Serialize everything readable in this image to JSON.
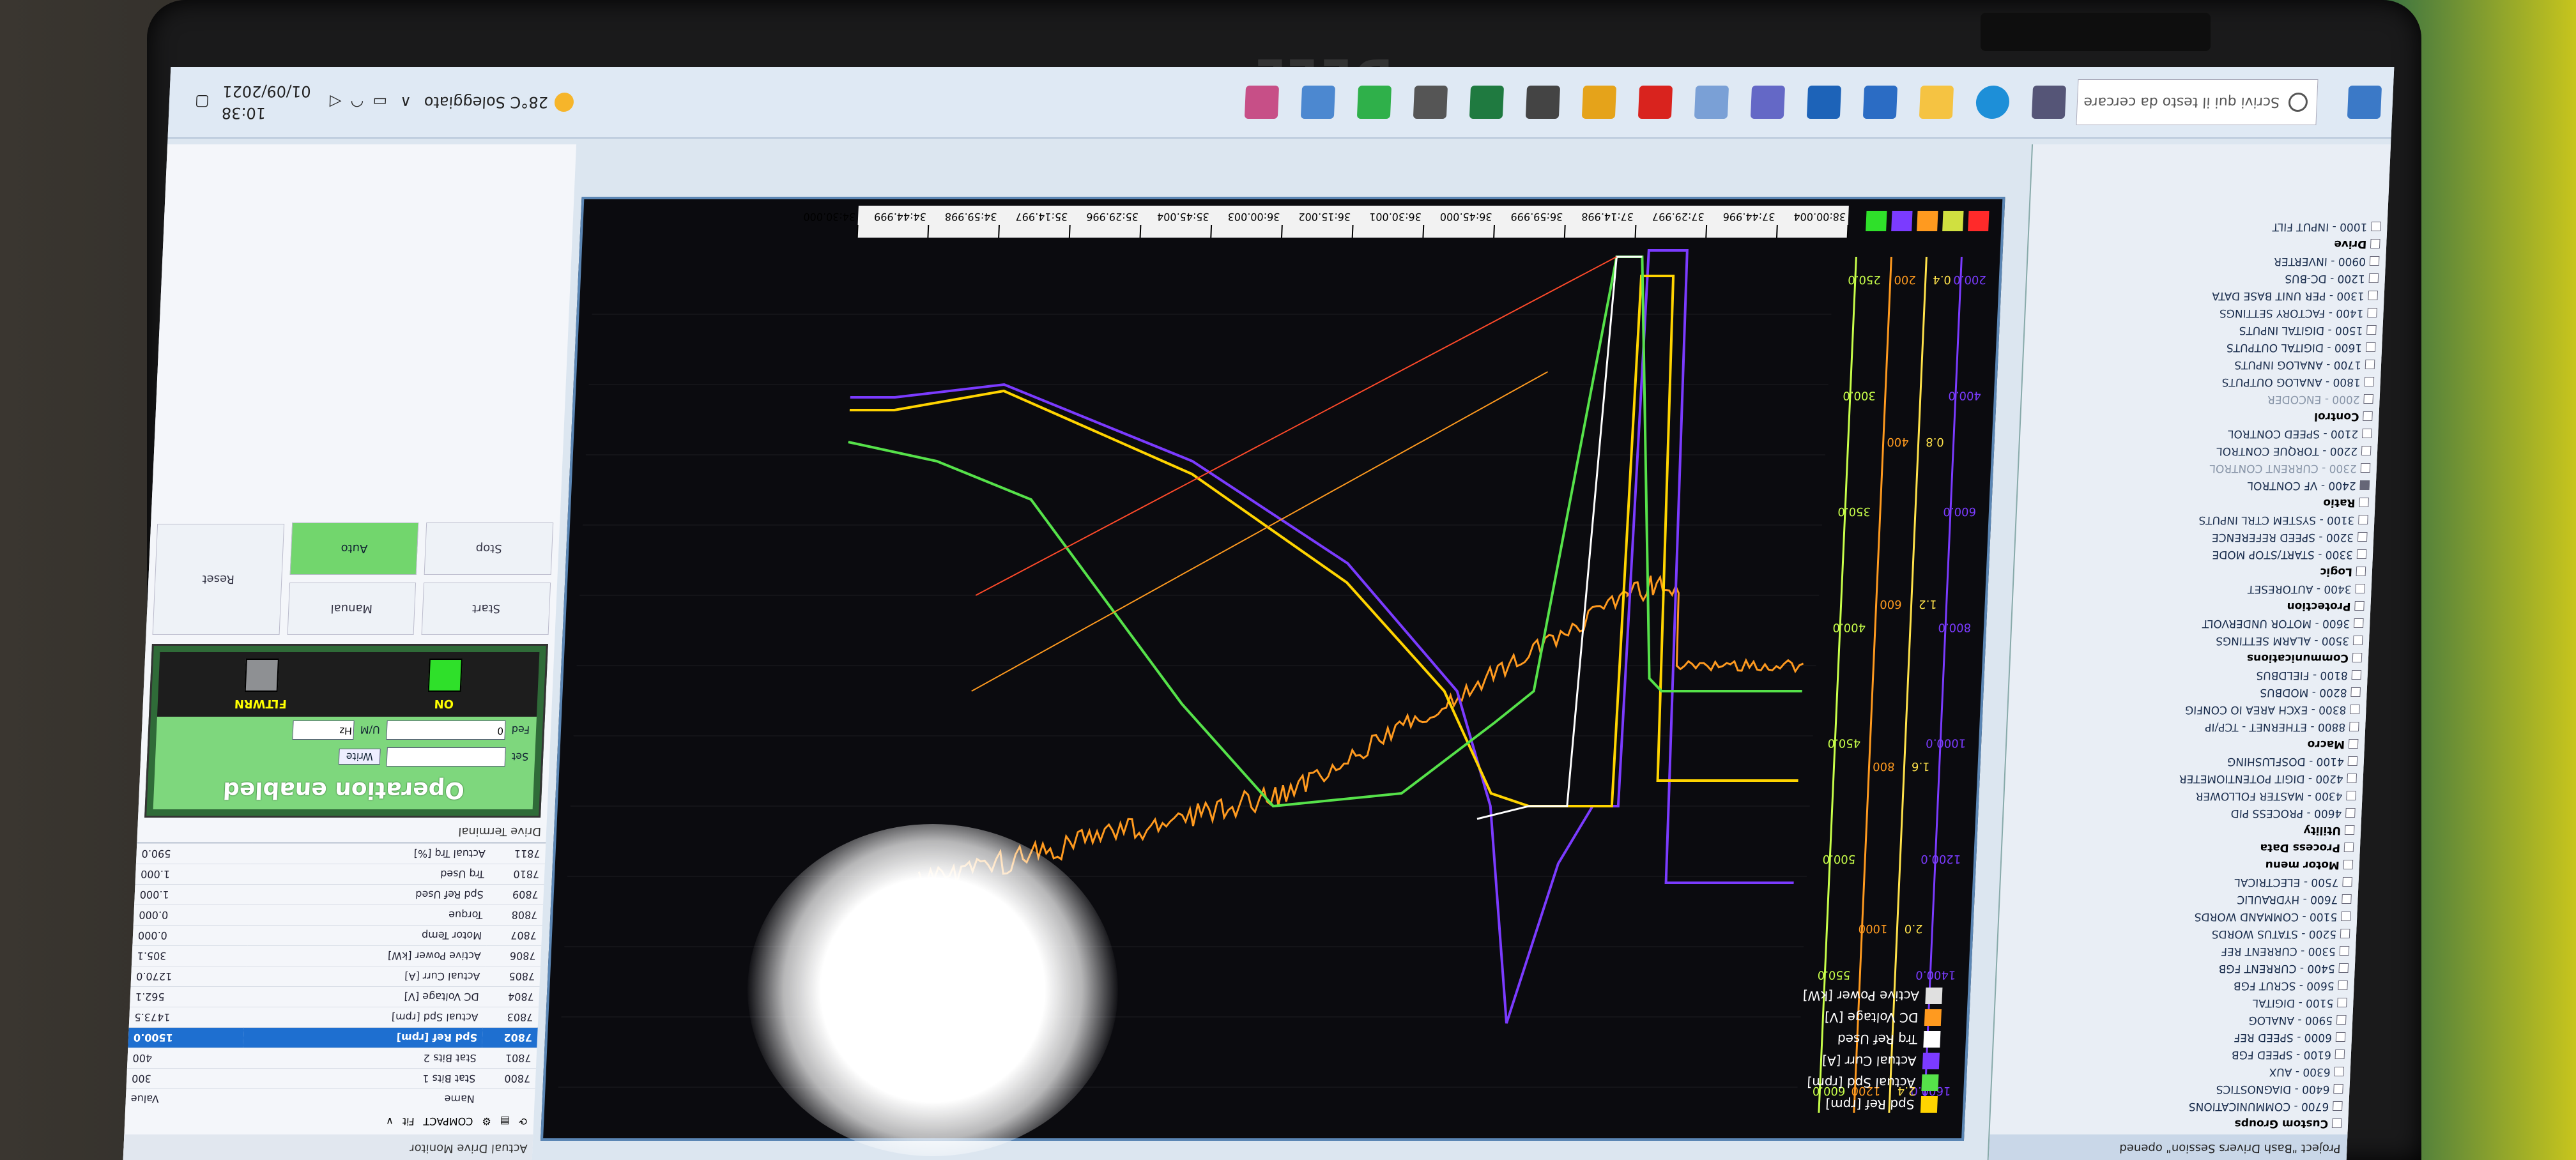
{
  "laptop": {
    "brand": "DELL"
  },
  "taskbar": {
    "search_placeholder": "Scrivi qui il testo da cercare",
    "weather": "28°C Soleggiato",
    "time": "10:38",
    "date": "01/09/2021"
  },
  "tree": {
    "title": "Project \"Bash Drivers Session\" opened",
    "items": [
      {
        "label": "Custom Groups",
        "type": "group"
      },
      {
        "label": "6700 - COMMUNICATIONS",
        "type": "item"
      },
      {
        "label": "6400 - DIAGNOSTICS",
        "type": "item"
      },
      {
        "label": "6300 - AUX",
        "type": "item"
      },
      {
        "label": "6100 - SPEED FGB",
        "type": "item"
      },
      {
        "label": "6000 - SPEED REF",
        "type": "item"
      },
      {
        "label": "5900 - ANALOG",
        "type": "item"
      },
      {
        "label": "5100 - DIGITAL",
        "type": "item"
      },
      {
        "label": "5600 - SCRUT FGB",
        "type": "item"
      },
      {
        "label": "5400 - CURRENT FGB",
        "type": "item"
      },
      {
        "label": "5300 - CURRENT REF",
        "type": "item"
      },
      {
        "label": "5200 - STATUS WORDS",
        "type": "item"
      },
      {
        "label": "5100 - COMMAND WORDS",
        "type": "item"
      },
      {
        "label": "7600 - HYDRAULIC",
        "type": "item"
      },
      {
        "label": "7500 - ELECTRICAL",
        "type": "item"
      },
      {
        "label": "Motor menu",
        "type": "group"
      },
      {
        "label": "Process Data",
        "type": "group"
      },
      {
        "label": "Utility",
        "type": "group"
      },
      {
        "label": "4600 - PROCESS PID",
        "type": "item"
      },
      {
        "label": "4300 - MASTER FOLLOWER",
        "type": "item"
      },
      {
        "label": "4200 - DIGIT POTENTIOMETER",
        "type": "item"
      },
      {
        "label": "4100 - DOSFLUSHING",
        "type": "item"
      },
      {
        "label": "Macro",
        "type": "group"
      },
      {
        "label": "8800 - ETHERNET - TCP/IP",
        "type": "item"
      },
      {
        "label": "8300 - EXCH AREA IO CONFIG",
        "type": "item"
      },
      {
        "label": "8200 - MODBUS",
        "type": "item"
      },
      {
        "label": "8100 - FIELDBUS",
        "type": "item"
      },
      {
        "label": "Communications",
        "type": "group"
      },
      {
        "label": "3500 - ALARM SETTINGS",
        "type": "item"
      },
      {
        "label": "3600 - MOTOR UNDERVOLT",
        "type": "item"
      },
      {
        "label": "Protection",
        "type": "group"
      },
      {
        "label": "3400 - AUTORESET",
        "type": "item"
      },
      {
        "label": "Logic",
        "type": "group"
      },
      {
        "label": "3300 - START/STOP MODE",
        "type": "item"
      },
      {
        "label": "3200 - SPEED REFERENCE",
        "type": "item"
      },
      {
        "label": "3100 - SYSTEM CTRL INPUTS",
        "type": "item"
      },
      {
        "label": "Ratio",
        "type": "group"
      },
      {
        "label": "2400 - VF CONTROL",
        "type": "item",
        "sel": true
      },
      {
        "label": "2300 - CURRENT CONTROL",
        "type": "dis"
      },
      {
        "label": "2200 - TORQUE CONTROL",
        "type": "item"
      },
      {
        "label": "2100 - SPEED CONTROL",
        "type": "item"
      },
      {
        "label": "Control",
        "type": "group"
      },
      {
        "label": "2000 - ENCODER",
        "type": "dis"
      },
      {
        "label": "1800 - ANALOG OUTPUTS",
        "type": "item"
      },
      {
        "label": "1700 - ANALOG INPUTS",
        "type": "item"
      },
      {
        "label": "1600 - DIGITAL OUTPUTS",
        "type": "item"
      },
      {
        "label": "1500 - DIGITAL INPUTS",
        "type": "item"
      },
      {
        "label": "1400 - FACTORY SETTINGS",
        "type": "item"
      },
      {
        "label": "1300 - PER UNIT BASE DATA",
        "type": "item"
      },
      {
        "label": "1200 - DC-BUS",
        "type": "item"
      },
      {
        "label": "0900 - INVERTER",
        "type": "item"
      },
      {
        "label": "Drive",
        "type": "group"
      },
      {
        "label": "1000 - INPUT FILT",
        "type": "item"
      }
    ]
  },
  "timeline": {
    "ticks": [
      "38:00.004",
      "37:44.996",
      "37:29.997",
      "37:14.998",
      "36:59.999",
      "36:45.000",
      "36:30.001",
      "36:15.002",
      "36:00.003",
      "35:45.004",
      "35:29.996",
      "35:14.997",
      "34:59.998",
      "34:44.999",
      "34:30.000"
    ]
  },
  "chart_data": {
    "type": "line",
    "scales": [
      {
        "color": "#7b3bff",
        "ticks": [
          "1600.0",
          "1400.0",
          "1200.0",
          "1000.0",
          "800.0",
          "600.0",
          "400.0",
          "200.0"
        ]
      },
      {
        "color": "#ffe24a",
        "ticks": [
          "2.4",
          "2.0",
          "1.6",
          "1.2",
          "0.8",
          "0.4"
        ]
      },
      {
        "color": "#ff9a1f",
        "ticks": [
          "1200",
          "1000",
          "800",
          "600",
          "400",
          "200"
        ]
      },
      {
        "color": "#c8ff4a",
        "ticks": [
          "600.0",
          "550.0",
          "500.0",
          "450.0",
          "400.0",
          "350.0",
          "300.0",
          "250.0"
        ]
      }
    ],
    "series": [
      {
        "name": "Spd Ref [rpm]",
        "color": "#ffd400"
      },
      {
        "name": "Actual Spd [rpm]",
        "color": "#56e24a"
      },
      {
        "name": "Actual Curr [A]",
        "color": "#7b3bff"
      },
      {
        "name": "Trq Ref Used",
        "color": "#ffffff"
      },
      {
        "name": "DC Voltage [V]",
        "color": "#ff9a1f"
      },
      {
        "name": "Active Power [kW]",
        "color": "#e0e0e0"
      }
    ]
  },
  "drive": {
    "title": "Actual Drive Monitor",
    "toolbar": [
      "COMPACT",
      "Fit",
      "∨"
    ],
    "headers": [
      "Name",
      "Value"
    ],
    "params": [
      {
        "id": "",
        "name": "Name",
        "value": "Value",
        "hl": false
      },
      {
        "id": "7800",
        "name": "Stat Bits 1",
        "value": "300",
        "hl": false
      },
      {
        "id": "7801",
        "name": "Stat Bits 2",
        "value": "400",
        "hl": false
      },
      {
        "id": "7802",
        "name": "Spd Ref [rpm]",
        "value": "1500.0",
        "hl": true
      },
      {
        "id": "7803",
        "name": "Actual Spd [rpm]",
        "value": "1473.5",
        "hl": false
      },
      {
        "id": "7804",
        "name": "DC Voltage [V]",
        "value": "562.1",
        "hl": false
      },
      {
        "id": "7805",
        "name": "Actual Curr [A]",
        "value": "1270.0",
        "hl": false
      },
      {
        "id": "7806",
        "name": "Active Power [kW]",
        "value": "305.1",
        "hl": false
      },
      {
        "id": "7807",
        "name": "Motor Temp",
        "value": "0.000",
        "hl": false
      },
      {
        "id": "7808",
        "name": "Torque",
        "value": "0.000",
        "hl": false
      },
      {
        "id": "7809",
        "name": "Spd Ref Used",
        "value": "1.000",
        "hl": false
      },
      {
        "id": "7810",
        "name": "Trq Used",
        "value": "1.000",
        "hl": false
      },
      {
        "id": "7811",
        "name": "Actual Trq [%]",
        "value": "590.0",
        "hl": false
      }
    ]
  },
  "terminal": {
    "title": "Drive Terminal",
    "op_label": "Operation enabled",
    "set_label": "Set",
    "fed_label": "Fed",
    "write_label": "Write",
    "um_label": "U/M",
    "um_value": "Hz",
    "fed_value": "0",
    "on_label": "ON",
    "fltwrn_label": "FLTWRN",
    "on_color": "#2fe02a",
    "flt_color": "#8e9093"
  },
  "buttons": {
    "start": "Start",
    "manual": "Manual",
    "stop": "Stop",
    "auto": "Auto",
    "reset": "Reset"
  }
}
